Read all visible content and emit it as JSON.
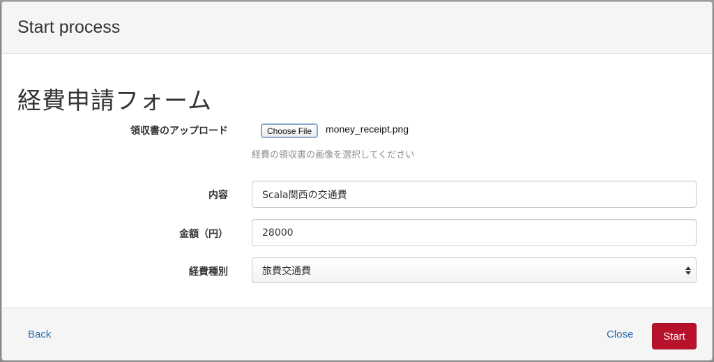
{
  "modal": {
    "title": "Start process"
  },
  "form": {
    "title": "経費申請フォーム",
    "upload": {
      "label": "領収書のアップロード",
      "button_label": "Choose File",
      "file_name": "money_receipt.png",
      "help": "経費の領収書の画像を選択してください"
    },
    "content": {
      "label": "内容",
      "value": "Scala関西の交通費"
    },
    "amount": {
      "label": "金額（円）",
      "value": "28000"
    },
    "category": {
      "label": "経費種別",
      "selected": "旅費交通費"
    }
  },
  "footer": {
    "back_label": "Back",
    "close_label": "Close",
    "start_label": "Start"
  },
  "colors": {
    "accent_link": "#2a6ab2",
    "start_button": "#b8112c"
  }
}
